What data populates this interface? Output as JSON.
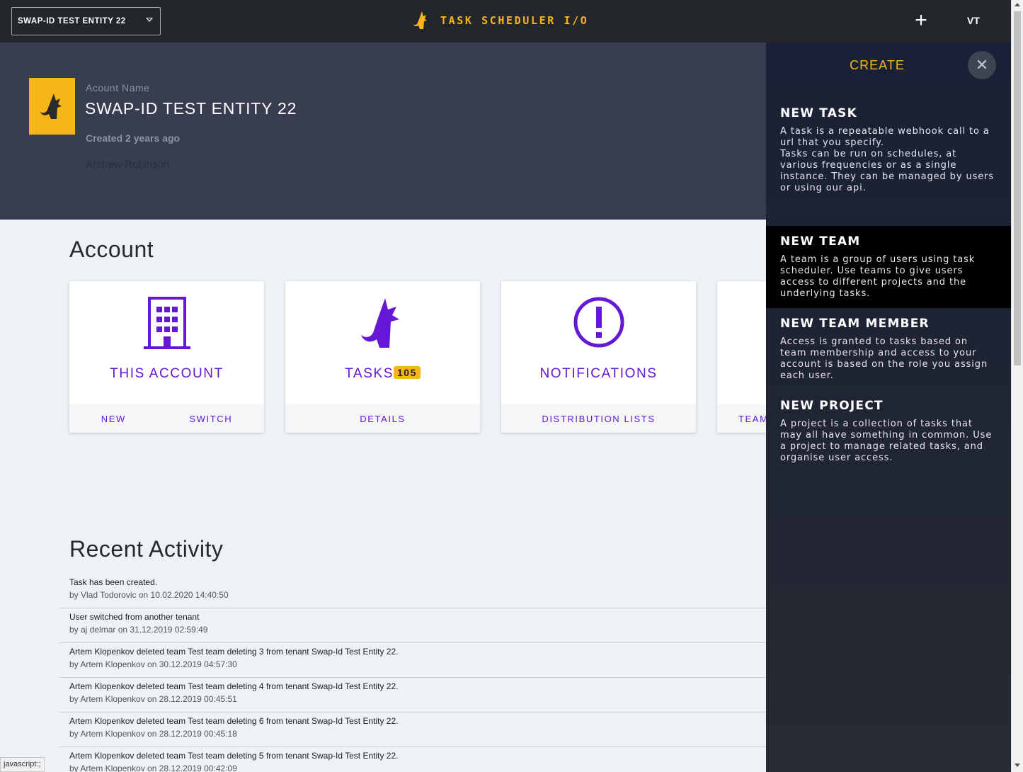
{
  "topbar": {
    "tenant_selector": "SWAP-ID TEST ENTITY 22",
    "brand_title": "TASK SCHEDULER I/O",
    "user_initials": "VT",
    "add_icon": "plus-icon"
  },
  "account_header": {
    "label": "Acount Name",
    "name": "SWAP-ID TEST ENTITY 22",
    "created": "Created 2 years ago",
    "owner": "Andrew Robinson"
  },
  "account_section": {
    "title": "Account",
    "cards": [
      {
        "title": "THIS ACCOUNT",
        "icon": "building-icon",
        "actions": [
          "NEW",
          "SWITCH"
        ]
      },
      {
        "title": "TASKS",
        "badge": "105",
        "icon": "fox-icon",
        "actions": [
          "DETAILS"
        ]
      },
      {
        "title": "NOTIFICATIONS",
        "icon": "alert-circle-icon",
        "actions": [
          "DISTRIBUTION LISTS"
        ]
      },
      {
        "title": "",
        "icon": "",
        "actions": [
          "TEAM"
        ]
      }
    ]
  },
  "activity": {
    "title": "Recent Activity",
    "items": [
      {
        "message": "Task has been created.",
        "meta": "by Vlad Todorovic on 10.02.2020 14:40:50"
      },
      {
        "message": "User switched from another tenant",
        "meta": "by aj delmar on 31.12.2019 02:59:49"
      },
      {
        "message": "Artem Klopenkov deleted team Test team deleting 3 from tenant Swap-Id Test Entity 22.",
        "meta": "by Artem Klopenkov on 30.12.2019 04:57:30"
      },
      {
        "message": "Artem Klopenkov deleted team Test team deleting 4 from tenant Swap-Id Test Entity 22.",
        "meta": "by Artem Klopenkov on 28.12.2019 00:45:51"
      },
      {
        "message": "Artem Klopenkov deleted team Test team deleting 6 from tenant Swap-Id Test Entity 22.",
        "meta": "by Artem Klopenkov on 28.12.2019 00:45:18"
      },
      {
        "message": "Artem Klopenkov deleted team Test team deleting 5 from tenant Swap-Id Test Entity 22.",
        "meta": "by Artem Klopenkov on 28.12.2019 00:42:09"
      }
    ]
  },
  "create_drawer": {
    "title": "CREATE",
    "close_icon": "close-icon",
    "items": [
      {
        "title": "NEW TASK",
        "description": "A task is a repeatable webhook call to a url that you specify.\nTasks can be run on schedules, at various frequencies or as a single instance. They can be managed by users or using our api."
      },
      {
        "title": "NEW TEAM",
        "description": "A team is a group of users using task scheduler. Use teams to give users access to different projects and the underlying tasks."
      },
      {
        "title": "NEW TEAM MEMBER",
        "description": "Access is granted to tasks based on team membership and access to your account is based on the role you assign each user."
      },
      {
        "title": "NEW PROJECT",
        "description": "A project is a collection of tasks that may all have something in common. Use a project to manage related tasks, and organise user access."
      }
    ]
  },
  "status_bar": {
    "text": "javascript:;"
  },
  "colors": {
    "accent": "#6418d6",
    "brand": "#f7b519",
    "topbar": "#23272c",
    "header": "#383d52",
    "drawer": "#1e2433"
  }
}
